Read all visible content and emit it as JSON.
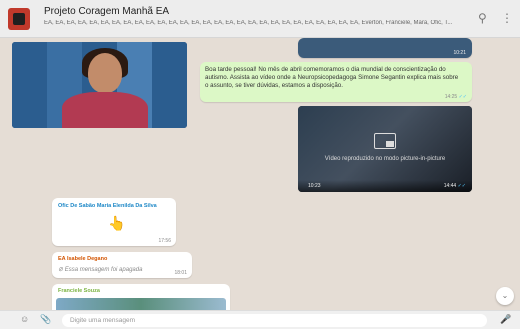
{
  "header": {
    "title": "Projeto Coragem Manhã EA",
    "subtitle": "EA, EA, EA, EA, EA, EA, EA, EA, EA, EA, EA, EA, EA, EA, EA, EA, EA, EA, EA, EA, EA, EA, EA, EA, EA, EA, EA, EA, Everton, Franciele, Mara, Ofic, T...",
    "search_icon": "search-icon",
    "menu_icon": "kebab-menu-icon"
  },
  "messages": {
    "top_video_time": "10:21",
    "text_message": {
      "text": "Boa tarde pessoal! No mês de abril comemoramos o dia mundial de conscientização do autismo. Assista ao vídeo onde a Neuropsicopedagoga Simone Segantin explica mais sobre o assunto, se tiver dúvidas, estamos a disposição.",
      "time": "14:25"
    },
    "video_message": {
      "pip_label": "Vídeo reproduzido no modo picture-in-picture",
      "duration": "10:23",
      "time": "14:44"
    },
    "incoming_1": {
      "sender": "Ofic De Sabão Maria Elenilda Da Silva",
      "emoji": "👆",
      "time": "17:56"
    },
    "incoming_2": {
      "sender": "EA Isabele Degano",
      "text": "Essa mensagem foi apagada",
      "time": "18:01"
    },
    "incoming_3": {
      "sender": "Franciele Souza"
    }
  },
  "footer": {
    "placeholder": "Digite uma mensagem",
    "emoji_icon": "emoji-icon",
    "attach_icon": "attach-icon",
    "mic_icon": "mic-icon"
  },
  "colors": {
    "outgoing": "#dcf8c6",
    "incoming": "#ffffff",
    "background": "#e5ddd5"
  }
}
